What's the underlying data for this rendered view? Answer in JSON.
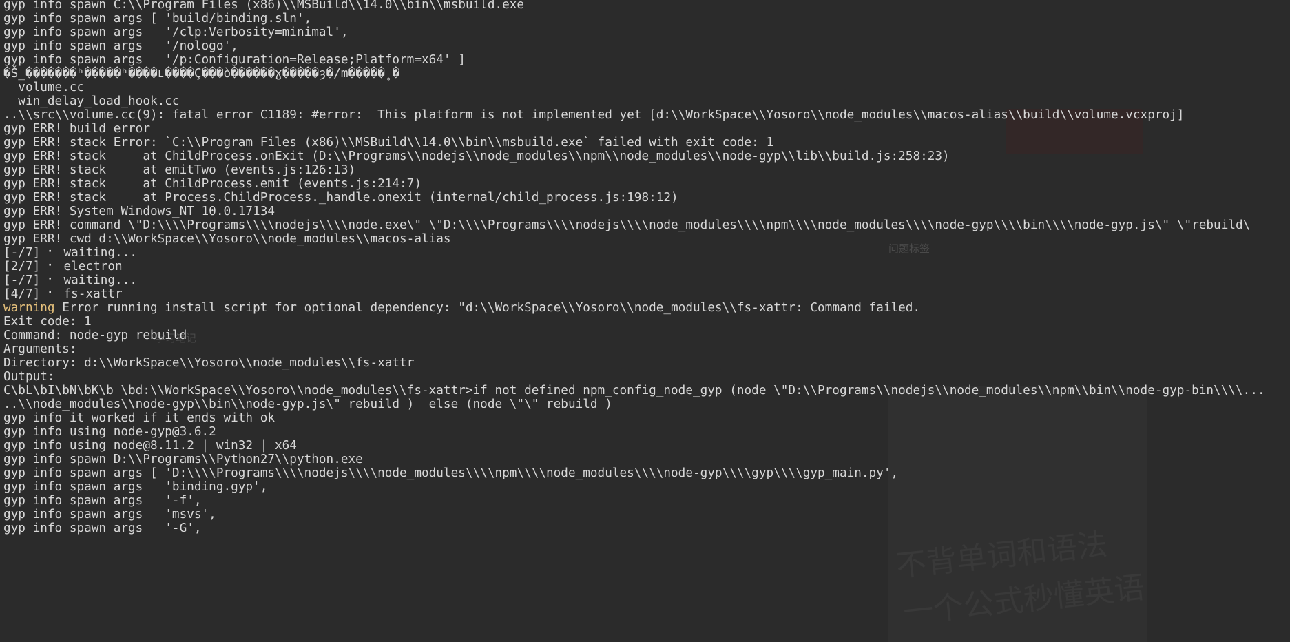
{
  "background": {
    "ghost_texts": [
      "学习笔记",
      "问题标签",
      "一个公式秒懂英语",
      "不背单词和语法"
    ]
  },
  "colors": {
    "background": "#2b2b2b",
    "text": "#d7d7d7",
    "warning": "#e5c07b"
  },
  "terminal": {
    "lines": [
      "gyp info spawn C:\\\\Program Files (x86)\\\\MSBuild\\\\14.0\\\\bin\\\\msbuild.exe",
      "gyp info spawn args [ 'build/binding.sln',",
      "gyp info spawn args   '/clp:Verbosity=minimal',",
      "gyp info spawn args   '/nologo',",
      "gyp info spawn args   '/p:Configuration=Release;Platform=x64' ]",
      "�Š_�������ʰ�����ʰ����ʟ����Ç���ò������ɣ�����ȝ�/m�����˳�",
      "  volume.cc",
      "  win_delay_load_hook.cc",
      "..\\\\src\\\\volume.cc(9): fatal error C1189: #error:  This platform is not implemented yet [d:\\\\WorkSpace\\\\Yosoro\\\\node_modules\\\\macos-alias\\\\build\\\\volume.vcxproj]",
      "gyp ERR! build error",
      "gyp ERR! stack Error: `C:\\\\Program Files (x86)\\\\MSBuild\\\\14.0\\\\bin\\\\msbuild.exe` failed with exit code: 1",
      "gyp ERR! stack     at ChildProcess.onExit (D:\\\\Programs\\\\nodejs\\\\node_modules\\\\npm\\\\node_modules\\\\node-gyp\\\\lib\\\\build.js:258:23)",
      "gyp ERR! stack     at emitTwo (events.js:126:13)",
      "gyp ERR! stack     at ChildProcess.emit (events.js:214:7)",
      "gyp ERR! stack     at Process.ChildProcess._handle.onexit (internal/child_process.js:198:12)",
      "gyp ERR! System Windows_NT 10.0.17134",
      "gyp ERR! command \\\"D:\\\\\\\\Programs\\\\\\\\nodejs\\\\\\\\node.exe\\\" \\\"D:\\\\\\\\Programs\\\\\\\\nodejs\\\\\\\\node_modules\\\\\\\\npm\\\\\\\\node_modules\\\\\\\\node-gyp\\\\\\\\bin\\\\\\\\node-gyp.js\\\" \\\"rebuild\\",
      "gyp ERR! cwd d:\\\\WorkSpace\\\\Yosoro\\\\node_modules\\\\macos-alias",
      "[-/7] ⠂ waiting...",
      "[2/7] ⠂ electron",
      "[-/7] ⠂ waiting...",
      "[4/7] ⠂ fs-xattr",
      "warning Error running install script for optional dependency: \"d:\\\\WorkSpace\\\\Yosoro\\\\node_modules\\\\fs-xattr: Command failed.",
      "Exit code: 1",
      "Command: node-gyp rebuild",
      "Arguments:",
      "Directory: d:\\\\WorkSpace\\\\Yosoro\\\\node_modules\\\\fs-xattr",
      "Output:",
      "C\\bL\\bI\\bN\\bK\\b \\bd:\\\\WorkSpace\\\\Yosoro\\\\node_modules\\\\fs-xattr>if not defined npm_config_node_gyp (node \\\"D:\\\\Programs\\\\nodejs\\\\node_modules\\\\npm\\\\bin\\\\node-gyp-bin\\\\\\\\...",
      "..\\\\node_modules\\\\node-gyp\\\\bin\\\\node-gyp.js\\\" rebuild )  else (node \\\"\\\" rebuild )",
      "gyp info it worked if it ends with ok",
      "gyp info using node-gyp@3.6.2",
      "gyp info using node@8.11.2 | win32 | x64",
      "gyp info spawn D:\\\\Programs\\\\Python27\\\\python.exe",
      "gyp info spawn args [ 'D:\\\\\\\\Programs\\\\\\\\nodejs\\\\\\\\node_modules\\\\\\\\npm\\\\\\\\node_modules\\\\\\\\node-gyp\\\\\\\\gyp\\\\\\\\gyp_main.py',",
      "gyp info spawn args   'binding.gyp',",
      "gyp info spawn args   '-f',",
      "gyp info spawn args   'msvs',",
      "gyp info spawn args   '-G',"
    ]
  }
}
